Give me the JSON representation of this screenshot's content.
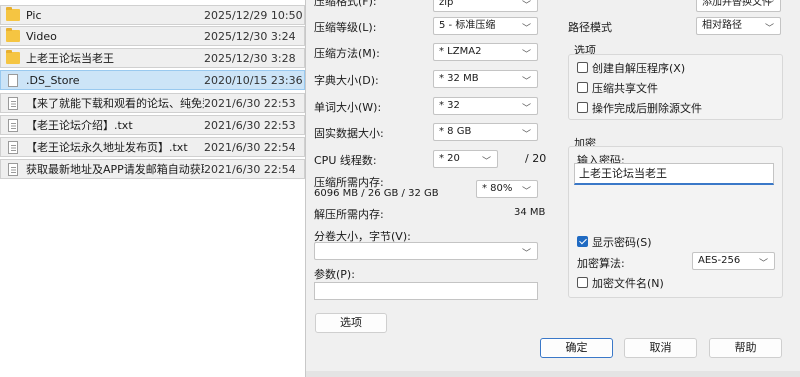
{
  "files": [
    {
      "name": "Pic",
      "date": "2025/12/29 10:50",
      "kind": "folder"
    },
    {
      "name": "Video",
      "date": "2025/12/30 3:24",
      "kind": "folder"
    },
    {
      "name": "上老王论坛当老王",
      "date": "2025/12/30 3:28",
      "kind": "folder"
    },
    {
      "name": ".DS_Store",
      "date": "2020/10/15 23:36",
      "kind": "file",
      "selected": true
    },
    {
      "name": "【来了就能下载和观看的论坛、纯免费！...",
      "date": "2021/6/30 22:53",
      "kind": "text"
    },
    {
      "name": "【老王论坛介绍】.txt",
      "date": "2021/6/30 22:53",
      "kind": "text"
    },
    {
      "name": "【老王论坛永久地址发布页】.txt",
      "date": "2021/6/30 22:54",
      "kind": "text"
    },
    {
      "name": "获取最新地址及APP请发邮箱自动获取.txt",
      "date": "2021/6/30 22:54",
      "kind": "text"
    }
  ],
  "left": {
    "top_label": "压缩格式(F):",
    "top_value": "zip",
    "level_label": "压缩等级(L):",
    "level_value": "5 - 标准压缩",
    "method_label": "压缩方法(M):",
    "method_value": "* LZMA2",
    "dict_label": "字典大小(D):",
    "dict_value": "* 32 MB",
    "word_label": "单词大小(W):",
    "word_value": "* 32",
    "solid_label": "固实数据大小:",
    "solid_value": "* 8 GB",
    "cpu_label": "CPU 线程数:",
    "cpu_value": "* 20",
    "cpu_total": "/ 20",
    "mem_comp_label": "压缩所需内存:",
    "mem_comp_detail": "6096 MB / 26 GB / 32 GB",
    "mem_comp_value": "* 80%",
    "mem_decomp_label": "解压所需内存:",
    "mem_decomp_value": "34 MB",
    "volume_label": "分卷大小，字节(V):",
    "volume_value": "",
    "params_label": "参数(P):",
    "params_value": "",
    "options_button": "选项"
  },
  "right": {
    "update_value": "添加并替换文件",
    "path_mode_label": "路径模式",
    "path_mode_value": "相对路径",
    "options_title": "选项",
    "opt_sfx": "创建自解压程序(X)",
    "opt_shared": "压缩共享文件",
    "opt_delete": "操作完成后删除源文件",
    "encrypt_title": "加密",
    "password_label": "输入密码:",
    "password_value": "上老王论坛当老王",
    "show_password": "显示密码(S)",
    "enc_method_label": "加密算法:",
    "enc_method_value": "AES-256",
    "enc_names": "加密文件名(N)"
  },
  "buttons": {
    "ok": "确定",
    "cancel": "取消",
    "help": "帮助"
  }
}
